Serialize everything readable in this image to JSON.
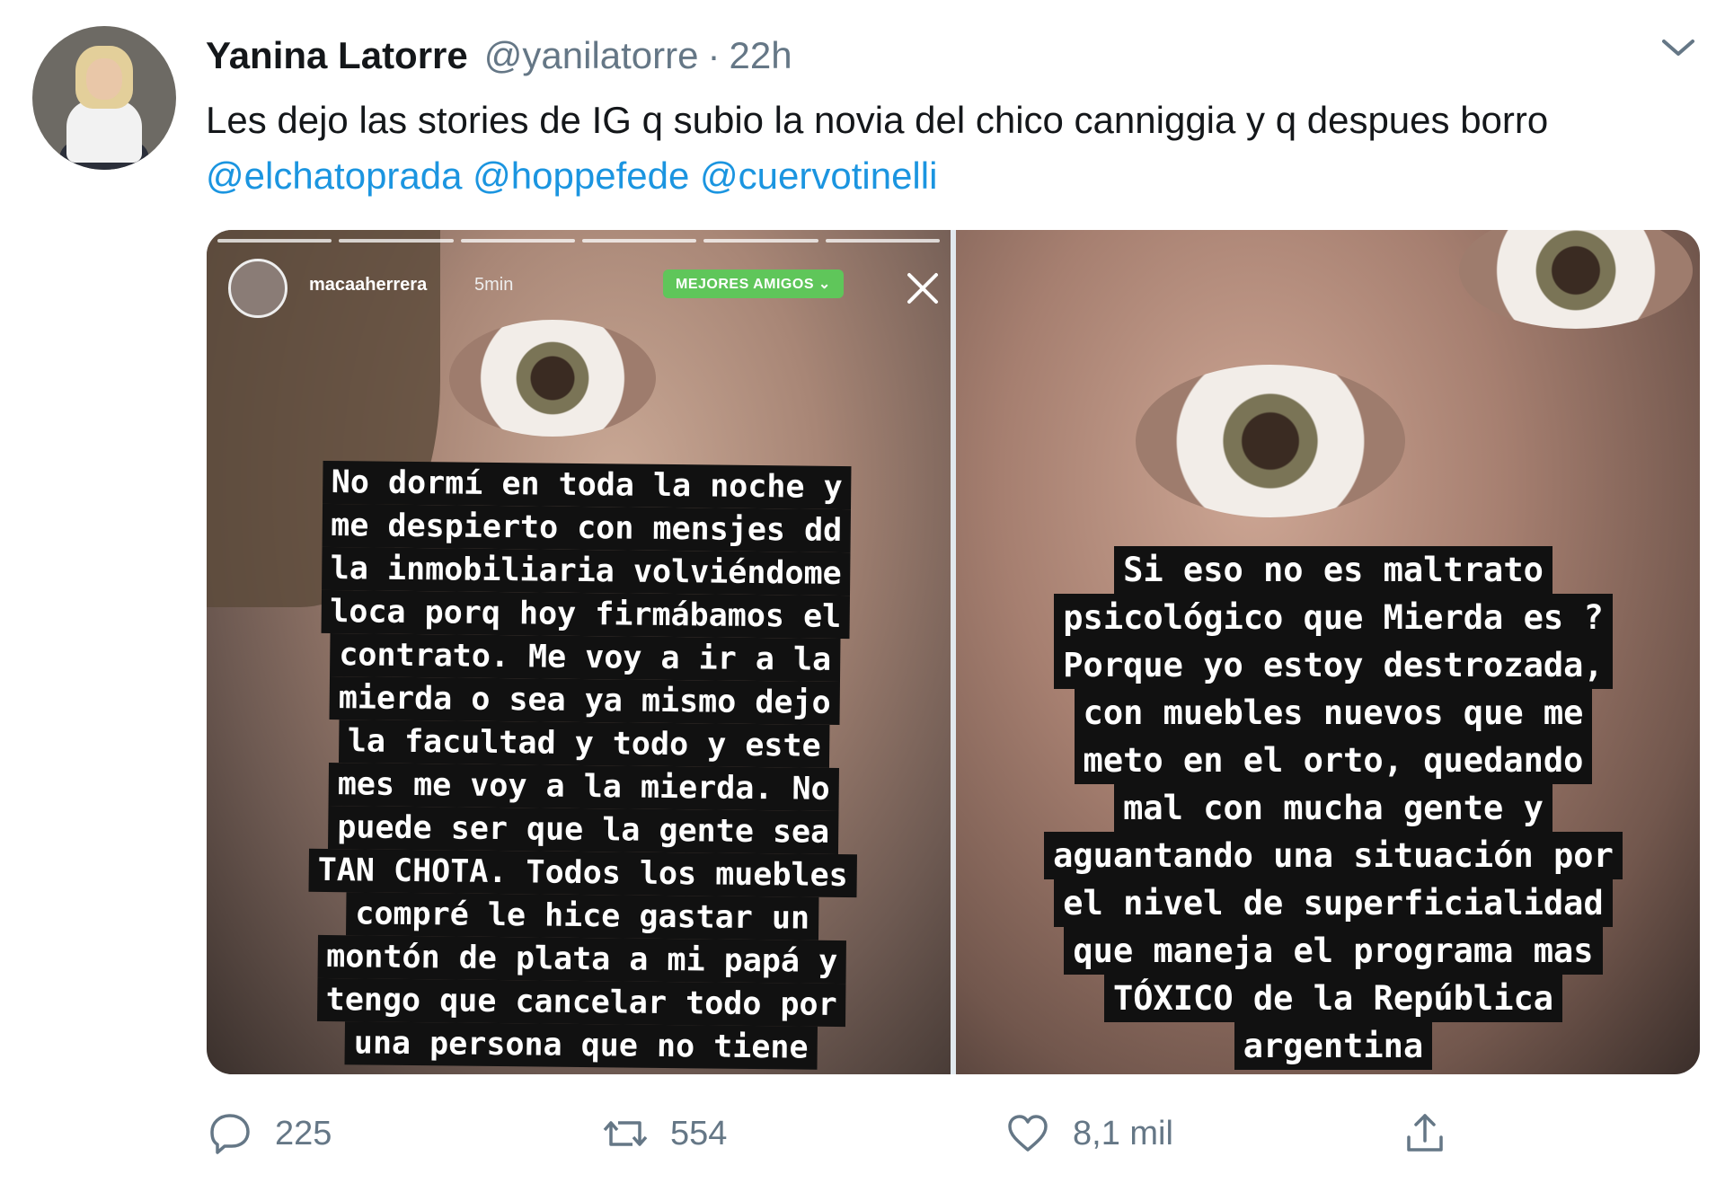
{
  "tweet": {
    "author_name": "Yanina Latorre",
    "handle": "@yanilatorre",
    "separator": "·",
    "time": "22h",
    "text_main": "Les dejo las stories de IG q subio la novia del chico canniggia y q despues borro",
    "mentions": [
      "@elchatoprada",
      "@hoppefede",
      "@cuervotinelli"
    ]
  },
  "story_left": {
    "username": "macaaherrera",
    "time": "5min",
    "badge": "MEJORES AMIGOS ⌄",
    "lines": [
      "No dormí en toda la noche y",
      "me despierto con mensjes dd",
      "la inmobiliaria volviéndome",
      "loca porq hoy firmábamos el",
      "contrato. Me voy a ir a la",
      "mierda o sea ya mismo dejo",
      "la facultad y todo y este",
      "mes me voy a la mierda. No",
      "puede ser que la gente sea",
      "TAN CHOTA. Todos los muebles",
      "compré le hice gastar un",
      "montón de plata a mi papá y",
      "tengo que cancelar todo por",
      "una persona que no tiene"
    ]
  },
  "story_right": {
    "lines": [
      "Si eso no es maltrato",
      "psicológico que Mierda es ?",
      "Porque yo estoy destrozada,",
      "con muebles nuevos que me",
      "meto en el orto, quedando",
      "mal con mucha gente y",
      "aguantando una situación por",
      "el nivel de superficialidad",
      "que maneja el programa mas",
      "TÓXICO de la República",
      "argentina"
    ]
  },
  "actions": {
    "replies": "225",
    "retweets": "554",
    "likes": "8,1 mil"
  },
  "colors": {
    "mention": "#1b95e0",
    "muted": "#657786",
    "badge": "#5fc65a"
  },
  "icons": {
    "reply": "reply-icon",
    "retweet": "retweet-icon",
    "like": "heart-icon",
    "share": "share-icon",
    "menu": "chevron-down-icon",
    "close": "close-icon"
  }
}
